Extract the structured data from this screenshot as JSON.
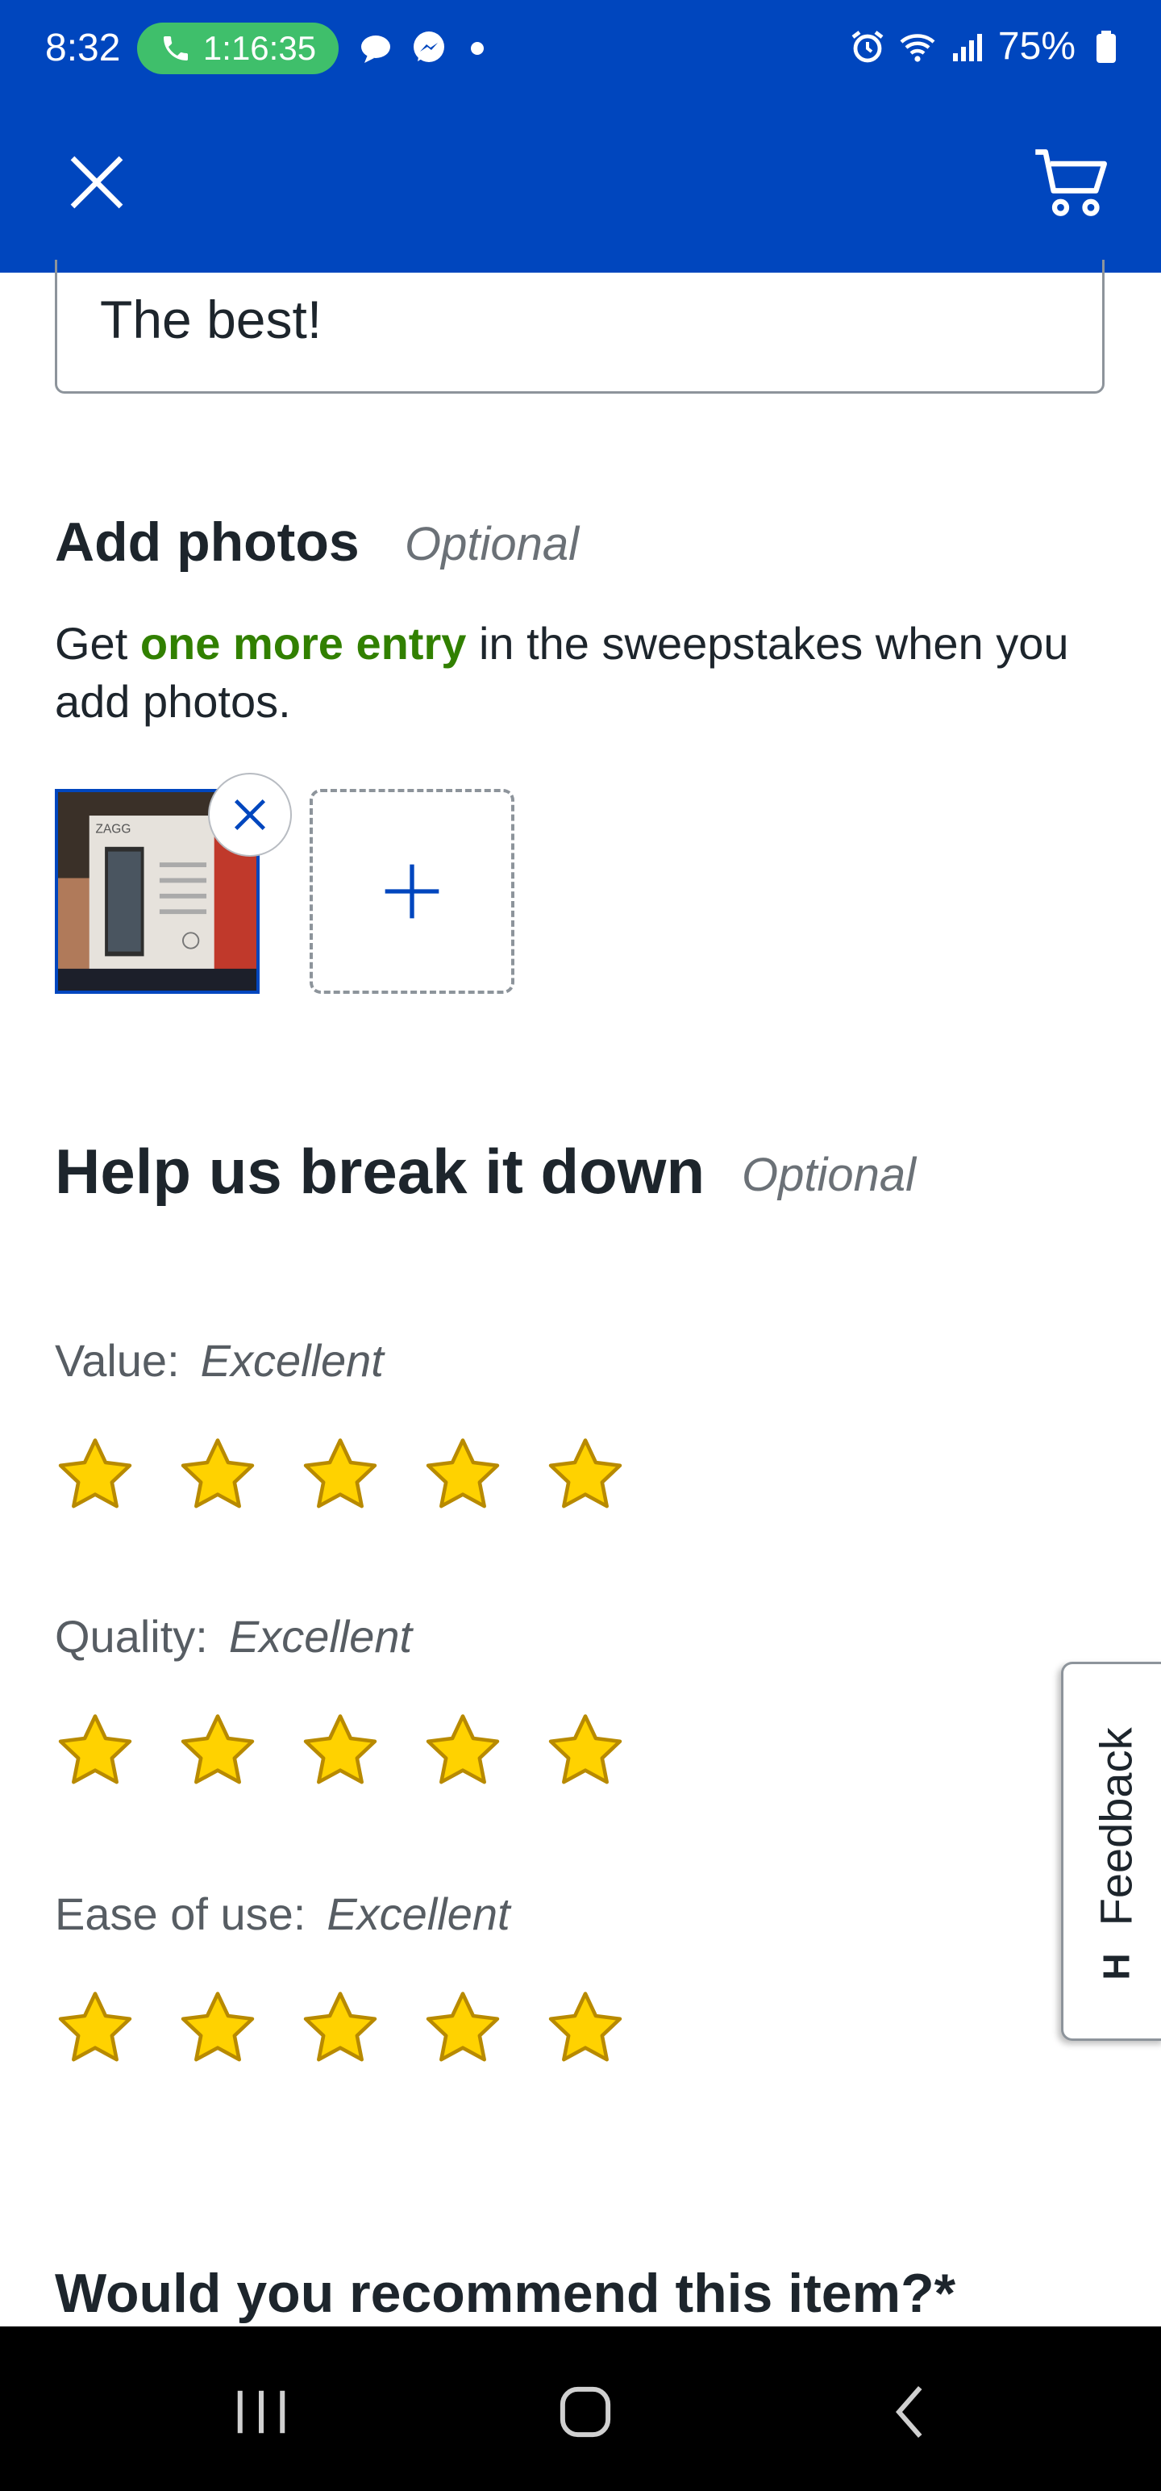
{
  "status_bar": {
    "time": "8:32",
    "call_timer": "1:16:35",
    "battery": "75%"
  },
  "review": {
    "text": "The best!"
  },
  "photos": {
    "heading": "Add photos",
    "optional": "Optional",
    "promo_pre": "Get ",
    "promo_highlight": "one more entry",
    "promo_post": " in the sweepstakes when you add photos.",
    "thumbnail_brand": "ZAGG"
  },
  "breakdown": {
    "heading": "Help us break it down",
    "optional": "Optional",
    "ratings": [
      {
        "label": "Value:",
        "value": "Excellent",
        "stars": 5
      },
      {
        "label": "Quality:",
        "value": "Excellent",
        "stars": 5
      },
      {
        "label": "Ease of use:",
        "value": "Excellent",
        "stars": 5
      }
    ]
  },
  "recommend": {
    "question": "Would you recommend this item?*"
  },
  "feedback_tab": {
    "label": "Feedback",
    "glyph": "H"
  },
  "colors": {
    "brand_blue": "#0046be",
    "promo_green": "#318000",
    "star_fill": "#ffd200",
    "star_stroke": "#b88a00",
    "call_green": "#3fbf6b"
  }
}
